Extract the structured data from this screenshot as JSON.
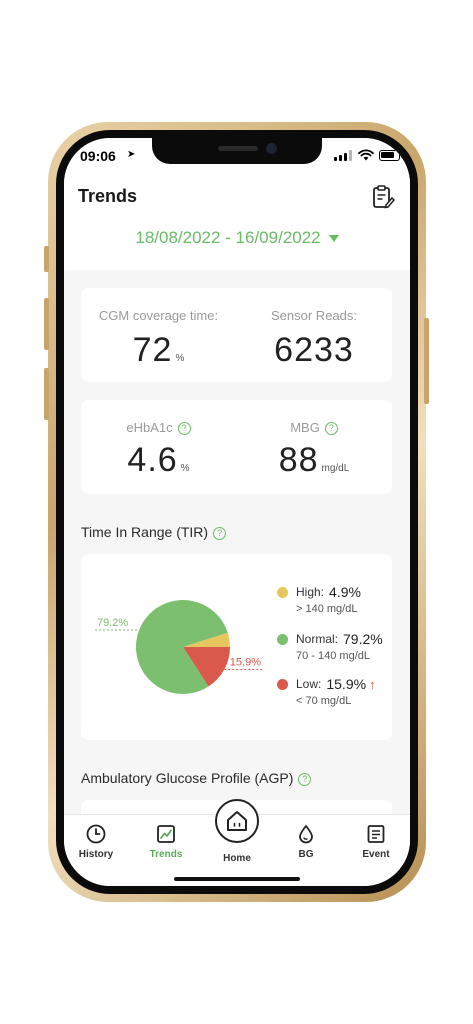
{
  "status_bar": {
    "time": "09:06"
  },
  "header": {
    "title": "Trends",
    "date_range": "18/08/2022 - 16/09/2022"
  },
  "coverage_card": {
    "cgm_label": "CGM coverage time:",
    "cgm_value": "72",
    "cgm_unit": "%",
    "reads_label": "Sensor Reads:",
    "reads_value": "6233"
  },
  "glucose_card": {
    "ehba1c_label": "eHbA1c",
    "ehba1c_value": "4.6",
    "ehba1c_unit": "%",
    "mbg_label": "MBG",
    "mbg_value": "88",
    "mbg_unit": "mg/dL"
  },
  "tir": {
    "section_title": "Time In Range (TIR)",
    "pie_label_normal": "79.2%",
    "pie_label_low": "15.9%",
    "legend": [
      {
        "name": "High:",
        "percent": "4.9%",
        "range": "> 140 mg/dL",
        "color": "#e8c65e"
      },
      {
        "name": "Normal:",
        "percent": "79.2%",
        "range": "70 - 140 mg/dL",
        "color": "#7cbf6e"
      },
      {
        "name": "Low:",
        "percent": "15.9%",
        "range": "< 70 mg/dL",
        "color": "#d9594c"
      }
    ]
  },
  "chart_data": {
    "type": "pie",
    "categories": [
      "High",
      "Normal",
      "Low"
    ],
    "values": [
      4.9,
      79.2,
      15.9
    ],
    "colors": [
      "#e8c65e",
      "#7cbf6e",
      "#d9594c"
    ]
  },
  "agp": {
    "section_title": "Ambulatory Glucose Profile (AGP)"
  },
  "tabs": {
    "history": "History",
    "trends": "Trends",
    "home": "Home",
    "bg": "BG",
    "event": "Event"
  },
  "colors": {
    "accent": "#6abb66",
    "active_tab": "#5aa956"
  }
}
